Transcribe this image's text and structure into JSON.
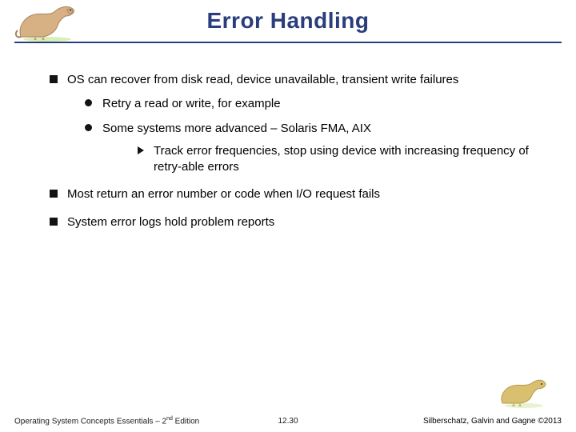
{
  "title": "Error Handling",
  "bullets": {
    "b1a": "OS can recover from disk read, device unavailable, transient write failures",
    "b2a": "Retry a read or write, for example",
    "b2b": "Some systems more advanced – Solaris FMA, AIX",
    "b3a": "Track error frequencies, stop using device with increasing frequency of retry-able errors",
    "b1b": "Most return an error number or code when I/O request fails",
    "b1c": "System error logs hold problem reports"
  },
  "footer": {
    "left_prefix": "Operating System Concepts Essentials – 2",
    "left_sup": "nd",
    "left_suffix": " Edition",
    "center": "12.30",
    "right": "Silberschatz, Galvin and Gagne ©2013"
  }
}
